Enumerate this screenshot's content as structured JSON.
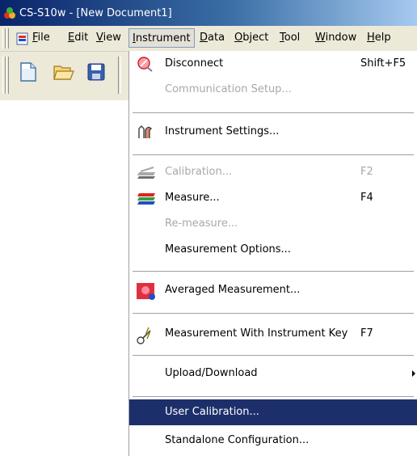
{
  "window": {
    "title": "CS-S10w - [New Document1]"
  },
  "menubar": {
    "items": [
      {
        "label": "File",
        "mnemonic": "F"
      },
      {
        "label": "Edit",
        "mnemonic": "E"
      },
      {
        "label": "View",
        "mnemonic": "V"
      },
      {
        "label": "Instrument",
        "mnemonic": "I"
      },
      {
        "label": "Data",
        "mnemonic": "D"
      },
      {
        "label": "Object",
        "mnemonic": "O"
      },
      {
        "label": "Tool",
        "mnemonic": "T"
      },
      {
        "label": "Window",
        "mnemonic": "W"
      },
      {
        "label": "Help",
        "mnemonic": "H"
      }
    ],
    "active": "Instrument"
  },
  "toolbar": {
    "buttons": [
      {
        "icon": "new-document-icon"
      },
      {
        "icon": "open-folder-icon"
      },
      {
        "icon": "save-disk-icon"
      }
    ]
  },
  "instrument_menu": {
    "items": [
      {
        "label": "Disconnect",
        "shortcut": "Shift+F5",
        "icon": "disconnect-icon",
        "enabled": true
      },
      {
        "label": "Communication Setup...",
        "shortcut": "",
        "icon": "",
        "enabled": false
      },
      {
        "label": "Instrument Settings...",
        "shortcut": "",
        "icon": "instrument-settings-icon",
        "enabled": true
      },
      {
        "label": "Calibration...",
        "shortcut": "F2",
        "icon": "calibration-icon",
        "enabled": false
      },
      {
        "label": "Measure...",
        "shortcut": "F4",
        "icon": "measure-icon",
        "enabled": true
      },
      {
        "label": "Re-measure...",
        "shortcut": "",
        "icon": "",
        "enabled": false
      },
      {
        "label": "Measurement Options...",
        "shortcut": "",
        "icon": "",
        "enabled": true
      },
      {
        "label": "Averaged Measurement...",
        "shortcut": "",
        "icon": "averaged-measurement-icon",
        "enabled": true
      },
      {
        "label": "Measurement With Instrument Key",
        "shortcut": "F7",
        "icon": "instrument-key-icon",
        "enabled": true
      },
      {
        "label": "Upload/Download",
        "shortcut": "",
        "icon": "submenu-arrow-icon",
        "enabled": true
      },
      {
        "label": "User Calibration...",
        "shortcut": "",
        "icon": "",
        "enabled": true,
        "highlighted": true
      },
      {
        "label": "Standalone Configuration...",
        "shortcut": "",
        "icon": "",
        "enabled": true
      }
    ]
  },
  "colors": {
    "title_bar": "#0a246a",
    "menu_bar": "#ece9d8",
    "highlight": "#1d2f6b",
    "disabled_text": "#a8a8a8"
  }
}
